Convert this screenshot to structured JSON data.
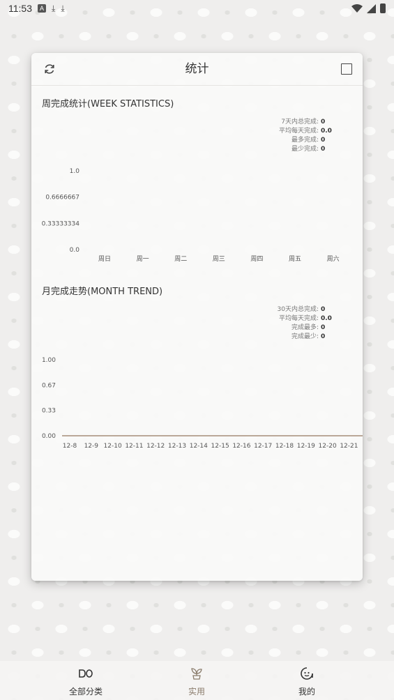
{
  "status_bar": {
    "time": "11:53",
    "icons": [
      "a-badge-icon",
      "download-icon",
      "download-icon"
    ],
    "right_icons": [
      "wifi-icon",
      "signal-icon",
      "battery-icon"
    ]
  },
  "header": {
    "title": "统计",
    "refresh_icon": "refresh-icon",
    "square_icon": "square-icon"
  },
  "week": {
    "title": "周完成统计(WEEK STATISTICS)",
    "stats": [
      {
        "label": "7天内总完成:",
        "value": "0"
      },
      {
        "label": "平均每天完成:",
        "value": "0.0"
      },
      {
        "label": "最多完成:",
        "value": "0"
      },
      {
        "label": "最少完成:",
        "value": "0"
      }
    ]
  },
  "month": {
    "title": "月完成走势(MONTH TREND)",
    "stats": [
      {
        "label": "30天内总完成:",
        "value": "0"
      },
      {
        "label": "平均每天完成:",
        "value": "0.0"
      },
      {
        "label": "完成最多:",
        "value": "0"
      },
      {
        "label": "完成最少:",
        "value": "0"
      }
    ]
  },
  "chart_data": [
    {
      "type": "bar",
      "categories": [
        "周日",
        "周一",
        "周二",
        "周三",
        "周四",
        "周五",
        "周六"
      ],
      "values": [
        0,
        0,
        0,
        0,
        0,
        0,
        0
      ],
      "ytick_labels": [
        "1.0",
        "0.6666667",
        "0.33333334",
        "0.0"
      ],
      "ylim": [
        0,
        1
      ]
    },
    {
      "type": "line",
      "categories": [
        "12-8",
        "12-9",
        "12-10",
        "12-11",
        "12-12",
        "12-13",
        "12-14",
        "12-15",
        "12-16",
        "12-17",
        "12-18",
        "12-19",
        "12-20",
        "12-21"
      ],
      "values": [
        0,
        0,
        0,
        0,
        0,
        0,
        0,
        0,
        0,
        0,
        0,
        0,
        0,
        0
      ],
      "ytick_labels": [
        "1.00",
        "0.67",
        "0.33",
        "0.00"
      ],
      "ylim": [
        0,
        1
      ],
      "line_color": "#a58e79"
    }
  ],
  "bottom_nav": {
    "items": [
      {
        "label": "全部分类",
        "icon": "categories-icon",
        "active": false
      },
      {
        "label": "实用",
        "icon": "sprout-icon",
        "active": true
      },
      {
        "label": "我的",
        "icon": "face-icon",
        "active": false
      }
    ]
  }
}
